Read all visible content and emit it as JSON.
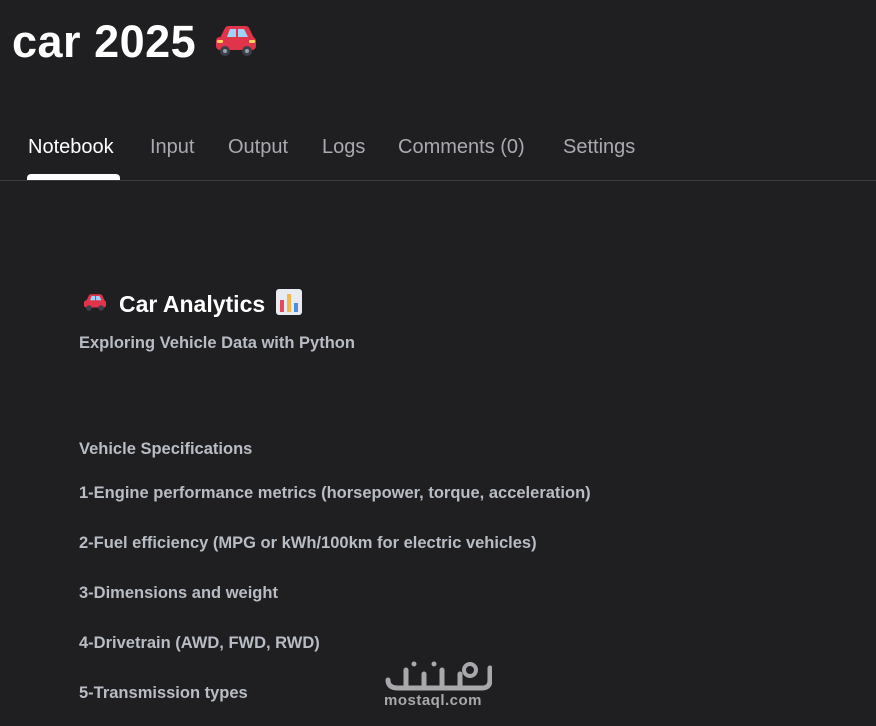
{
  "header": {
    "title": "car 2025",
    "title_icon": "car-icon"
  },
  "tabs": [
    {
      "label": "Notebook",
      "active": true
    },
    {
      "label": "Input",
      "active": false
    },
    {
      "label": "Output",
      "active": false
    },
    {
      "label": "Logs",
      "active": false
    },
    {
      "label": "Comments (0)",
      "active": false
    },
    {
      "label": "Settings",
      "active": false
    }
  ],
  "notebook": {
    "heading": "Car Analytics",
    "heading_icons": [
      "car-icon",
      "bar-chart-icon"
    ],
    "subtitle": "Exploring Vehicle Data with Python",
    "section_title": "Vehicle Specifications",
    "items": [
      "1-Engine performance metrics (horsepower, torque, acceleration)",
      "2-Fuel efficiency (MPG or kWh/100km for electric vehicles)",
      "3-Dimensions and weight",
      "4-Drivetrain (AWD, FWD, RWD)",
      "5-Transmission types"
    ]
  },
  "watermark": {
    "text": "mostaql.com"
  },
  "colors": {
    "background": "#1f1f22",
    "active_tab": "#ffffff",
    "inactive_tab": "#a9a9b0",
    "body_text": "#b8bcc4",
    "car_red": "#e0344a"
  }
}
